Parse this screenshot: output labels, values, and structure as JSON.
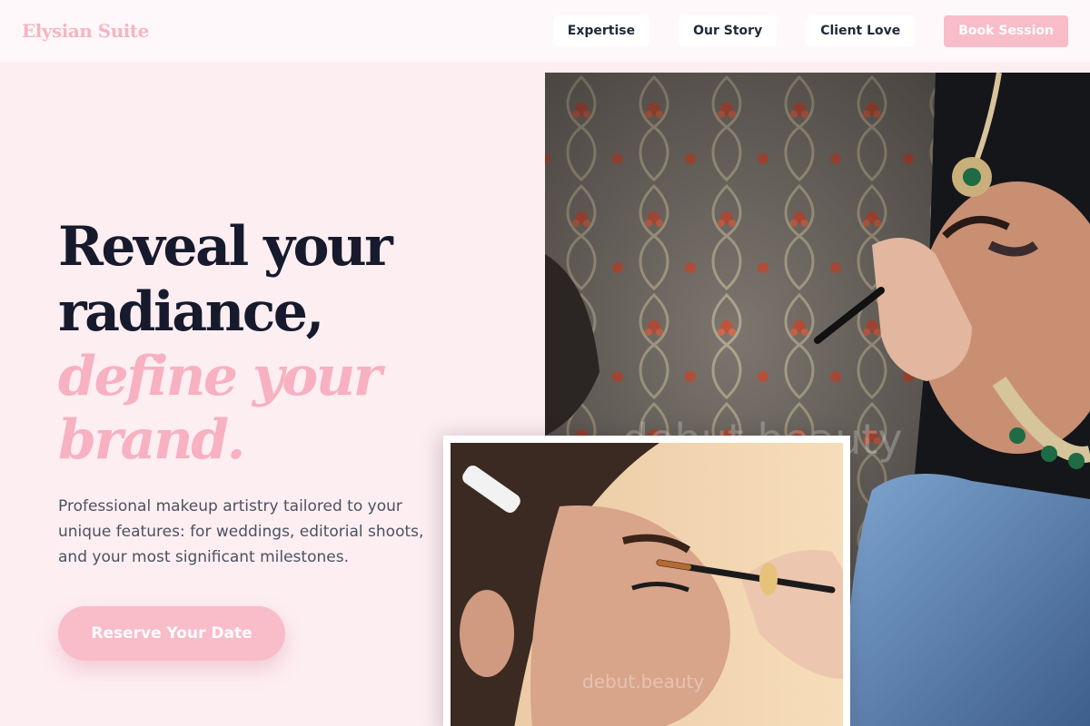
{
  "nav": {
    "brand": "Elysian Suite",
    "links": [
      "Expertise",
      "Our Story",
      "Client Love"
    ],
    "cta": "Book Session"
  },
  "hero": {
    "line1": "Reveal your",
    "line2": "radiance,",
    "accent1": "define your",
    "accent2": "brand.",
    "description": "Professional makeup artistry tailored to your unique features: for weddings, editorial shoots, and your most significant milestones.",
    "cta": "Reserve Your Date"
  },
  "images": {
    "main_watermark": "debut.beauty",
    "inset_watermark": "debut.beauty"
  },
  "colors": {
    "background": "#fdeef2",
    "accent": "#f7b1c1",
    "button": "#f9bcc9",
    "heading": "#161a2c"
  }
}
